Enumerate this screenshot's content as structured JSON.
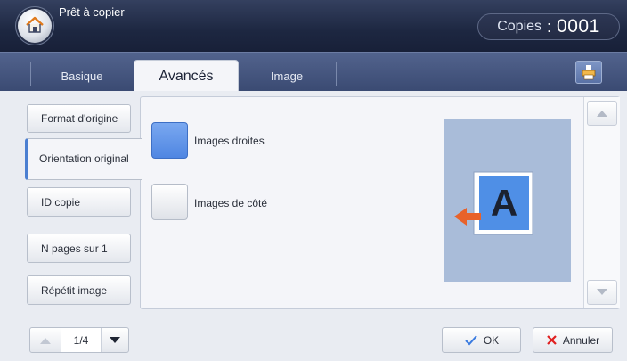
{
  "header": {
    "status": "Prêt à copier",
    "copies_label": "Copies",
    "copies_separator": ":",
    "copies_value": "0001"
  },
  "tabs": [
    {
      "label": "Basique",
      "active": false
    },
    {
      "label": "Avancés",
      "active": true
    },
    {
      "label": "Image",
      "active": false
    }
  ],
  "sidebar": {
    "items": [
      {
        "label": "Format d'origine"
      },
      {
        "label": "Orientation original",
        "active": true
      },
      {
        "label": "ID copie"
      },
      {
        "label": "N pages sur 1"
      },
      {
        "label": "Répétit image"
      }
    ]
  },
  "options": [
    {
      "label": "Images droites",
      "selected": true
    },
    {
      "label": "Images de côté",
      "selected": false
    }
  ],
  "preview": {
    "letter": "A"
  },
  "pager": {
    "text": "1/4"
  },
  "actions": {
    "ok_label": "OK",
    "cancel_label": "Annuler"
  },
  "colors": {
    "accent": "#4f86e2",
    "header": "#1d2741",
    "tabbar": "#46577f",
    "cancel": "#e02020",
    "ok": "#3a7be0",
    "arrow": "#e8622a"
  }
}
